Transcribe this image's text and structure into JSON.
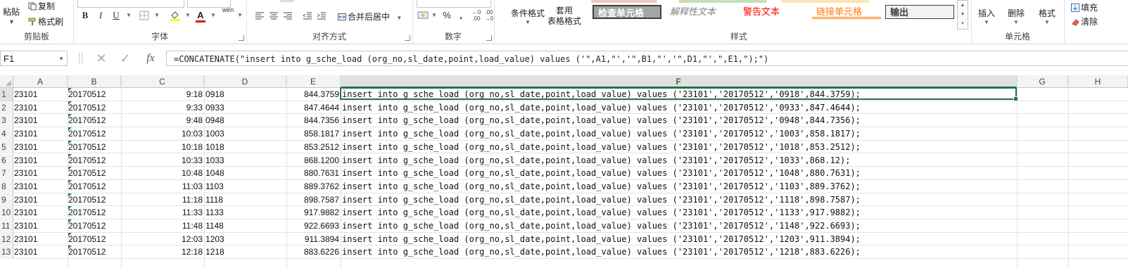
{
  "ribbon": {
    "clipboard": {
      "paste": "粘贴",
      "copy": "复制",
      "format_painter": "格式刷",
      "label": "剪贴板"
    },
    "font": {
      "label": "字体",
      "bold": "B",
      "italic": "I",
      "underline": "U",
      "font_color_letter": "A",
      "wen": "wén"
    },
    "alignment": {
      "label": "对齐方式",
      "merge_center": "合并后居中"
    },
    "number": {
      "label": "数字",
      "percent": "%",
      "comma": ","
    },
    "styles": {
      "label": "样式",
      "conditional_formatting": "条件格式",
      "format_as_table_1": "套用",
      "format_as_table_2": "表格格式",
      "check_cell": "检查单元格",
      "explanatory_text": "解释性文本",
      "warning_text": "警告文本",
      "linked_cell": "链接单元格",
      "output": "输出"
    },
    "cells": {
      "label": "单元格",
      "insert": "插入",
      "delete": "删除",
      "format": "格式"
    },
    "editing": {
      "fill": "填充",
      "clear": "清除"
    }
  },
  "formula_bar": {
    "name_box": "F1",
    "fx": "fx",
    "formula": "=CONCATENATE(\"insert into g_sche_load (org_no,sl_date,point,load_value) values ('\",A1,\"','\",B1,\"','\",D1,\"',\",E1,\");\")"
  },
  "columns": [
    "A",
    "B",
    "C",
    "D",
    "E",
    "F",
    "G",
    "H"
  ],
  "rows": [
    {
      "n": "1",
      "a": "23101",
      "b": "20170512",
      "c": "9:18",
      "d": "0918",
      "e": "844.3759",
      "f": "insert into g_sche_load (org_no,sl_date,point,load_value) values ('23101','20170512','0918',844.3759);"
    },
    {
      "n": "2",
      "a": "23101",
      "b": "20170512",
      "c": "9:33",
      "d": "0933",
      "e": "847.4644",
      "f": "insert into g_sche_load (org_no,sl_date,point,load_value) values ('23101','20170512','0933',847.4644);"
    },
    {
      "n": "3",
      "a": "23101",
      "b": "20170512",
      "c": "9:48",
      "d": "0948",
      "e": "844.7356",
      "f": "insert into g_sche_load (org_no,sl_date,point,load_value) values ('23101','20170512','0948',844.7356);"
    },
    {
      "n": "4",
      "a": "23101",
      "b": "20170512",
      "c": "10:03",
      "d": "1003",
      "e": "858.1817",
      "f": "insert into g_sche_load (org_no,sl_date,point,load_value) values ('23101','20170512','1003',858.1817);"
    },
    {
      "n": "5",
      "a": "23101",
      "b": "20170512",
      "c": "10:18",
      "d": "1018",
      "e": "853.2512",
      "f": "insert into g_sche_load (org_no,sl_date,point,load_value) values ('23101','20170512','1018',853.2512);"
    },
    {
      "n": "6",
      "a": "23101",
      "b": "20170512",
      "c": "10:33",
      "d": "1033",
      "e": "868.1200",
      "f": "insert into g_sche_load (org_no,sl_date,point,load_value) values ('23101','20170512','1033',868.12);"
    },
    {
      "n": "7",
      "a": "23101",
      "b": "20170512",
      "c": "10:48",
      "d": "1048",
      "e": "880.7631",
      "f": "insert into g_sche_load (org_no,sl_date,point,load_value) values ('23101','20170512','1048',880.7631);"
    },
    {
      "n": "8",
      "a": "23101",
      "b": "20170512",
      "c": "11:03",
      "d": "1103",
      "e": "889.3762",
      "f": "insert into g_sche_load (org_no,sl_date,point,load_value) values ('23101','20170512','1103',889.3762);"
    },
    {
      "n": "9",
      "a": "23101",
      "b": "20170512",
      "c": "11:18",
      "d": "1118",
      "e": "898.7587",
      "f": "insert into g_sche_load (org_no,sl_date,point,load_value) values ('23101','20170512','1118',898.7587);"
    },
    {
      "n": "10",
      "a": "23101",
      "b": "20170512",
      "c": "11:33",
      "d": "1133",
      "e": "917.9882",
      "f": "insert into g_sche_load (org_no,sl_date,point,load_value) values ('23101','20170512','1133',917.9882);"
    },
    {
      "n": "11",
      "a": "23101",
      "b": "20170512",
      "c": "11:48",
      "d": "1148",
      "e": "922.6693",
      "f": "insert into g_sche_load (org_no,sl_date,point,load_value) values ('23101','20170512','1148',922.6693);"
    },
    {
      "n": "12",
      "a": "23101",
      "b": "20170512",
      "c": "12:03",
      "d": "1203",
      "e": "911.3894",
      "f": "insert into g_sche_load (org_no,sl_date,point,load_value) values ('23101','20170512','1203',911.3894);"
    },
    {
      "n": "13",
      "a": "23101",
      "b": "20170512",
      "c": "12:18",
      "d": "1218",
      "e": "883.6226",
      "f": "insert into g_sche_load (org_no,sl_date,point,load_value) values ('23101','20170512','1218',883.6226);"
    }
  ],
  "colors": {
    "accent": "#217346",
    "selection_border": "#217346",
    "comment_triangle": "#1f8a3b"
  }
}
